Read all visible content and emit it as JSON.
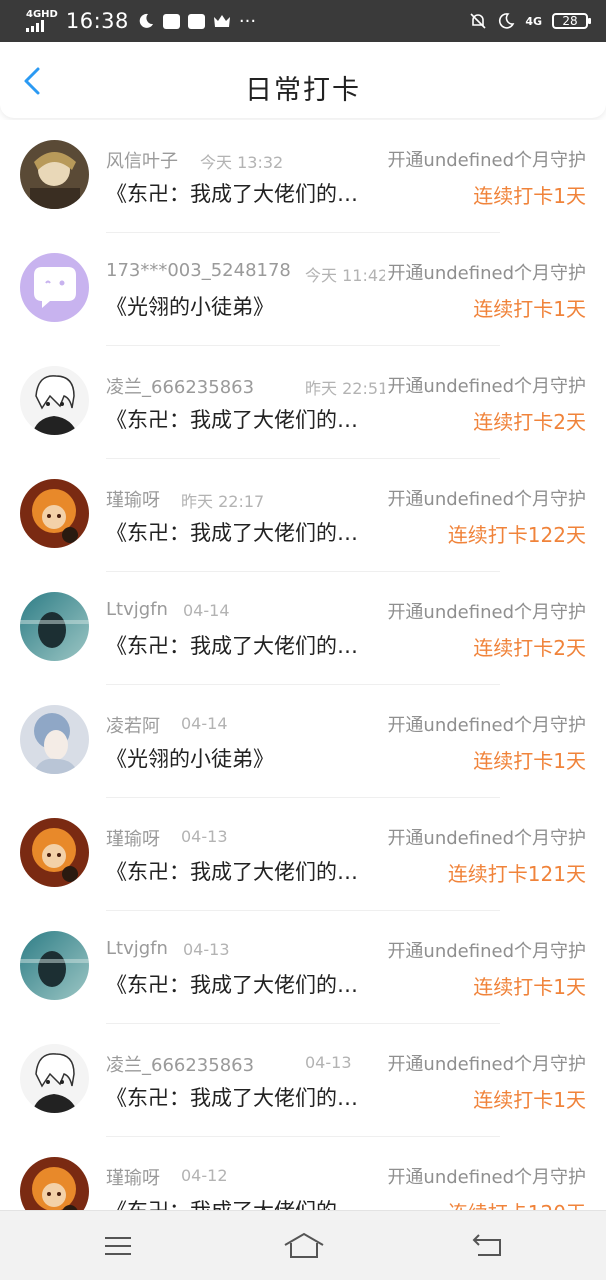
{
  "status_bar": {
    "network": "4GHD",
    "time": "16:38",
    "network_right": "4G",
    "battery": "28",
    "more": "···"
  },
  "header": {
    "title": "日常打卡"
  },
  "colors": {
    "accent": "#f0833a",
    "back_arrow": "#2b9af3",
    "status_bar_bg": "#3a3a3a"
  },
  "items": [
    {
      "name": "风信叶子",
      "time": "今天 13:32",
      "guard": "开通undefined个月守护",
      "book": "《东卍：我成了大佬们的白月光》",
      "streak": "连续打卡1天"
    },
    {
      "name": "173***003_5248178",
      "time": "今天 11:42",
      "guard": "开通undefined个月守护",
      "book": "《光翎的小徒弟》",
      "streak": "连续打卡1天"
    },
    {
      "name": "凌兰_666235863",
      "time": "昨天 22:51",
      "guard": "开通undefined个月守护",
      "book": "《东卍：我成了大佬们的白月光》",
      "streak": "连续打卡2天"
    },
    {
      "name": "瑾瑜呀",
      "time": "昨天 22:17",
      "guard": "开通undefined个月守护",
      "book": "《东卍：我成了大佬们的白月光》",
      "streak": "连续打卡122天"
    },
    {
      "name": "Ltvjgfn",
      "time": "04-14",
      "guard": "开通undefined个月守护",
      "book": "《东卍：我成了大佬们的白月光》",
      "streak": "连续打卡2天"
    },
    {
      "name": "凌若阿",
      "time": "04-14",
      "guard": "开通undefined个月守护",
      "book": "《光翎的小徒弟》",
      "streak": "连续打卡1天"
    },
    {
      "name": "瑾瑜呀",
      "time": "04-13",
      "guard": "开通undefined个月守护",
      "book": "《东卍：我成了大佬们的白月光》",
      "streak": "连续打卡121天"
    },
    {
      "name": "Ltvjgfn",
      "time": "04-13",
      "guard": "开通undefined个月守护",
      "book": "《东卍：我成了大佬们的白月光》",
      "streak": "连续打卡1天"
    },
    {
      "name": "凌兰_666235863",
      "time": "04-13",
      "guard": "开通undefined个月守护",
      "book": "《东卍：我成了大佬们的白月光》",
      "streak": "连续打卡1天"
    },
    {
      "name": "瑾瑜呀",
      "time": "04-12",
      "guard": "开通undefined个月守护",
      "book": "《东卍：我成了大佬们的白月光》",
      "streak": "连续打卡120天"
    }
  ],
  "avatars": [
    "leaf",
    "chat",
    "sketch",
    "orange",
    "teal",
    "blue",
    "orange",
    "teal",
    "sketch",
    "orange"
  ],
  "nav": {
    "menu_icon": "menu-icon",
    "home_icon": "home-icon",
    "back_icon": "back-icon"
  }
}
